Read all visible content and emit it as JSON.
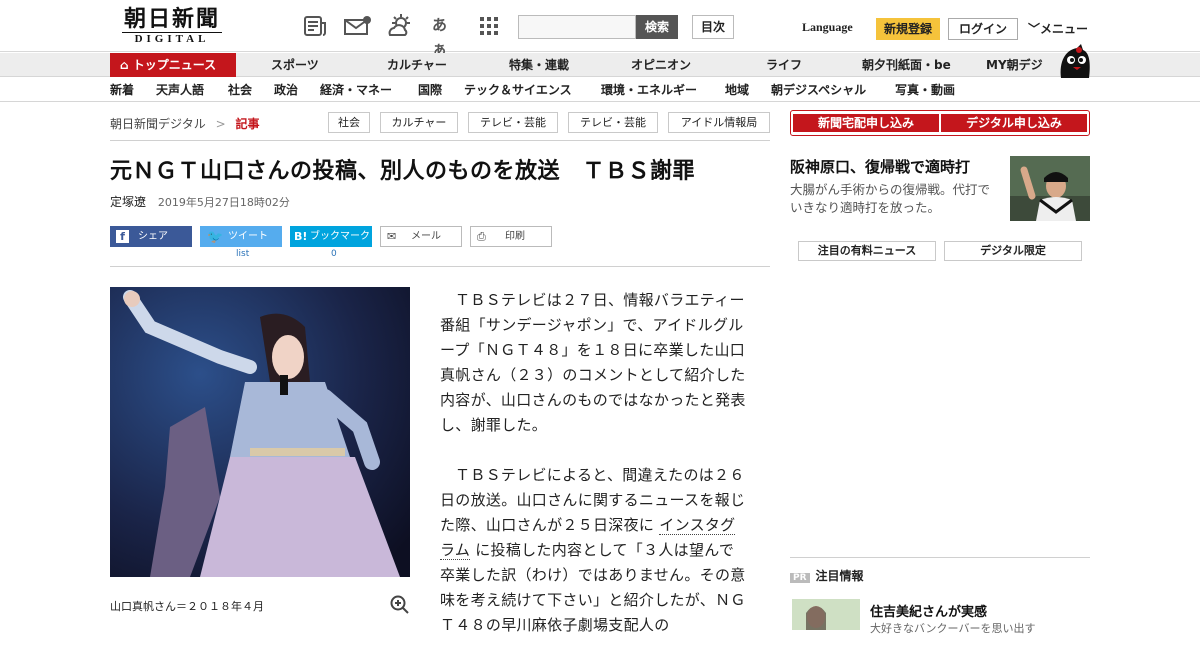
{
  "header": {
    "logo_jp": "朝日新聞",
    "logo_en": "DIGITAL",
    "search_button": "検索",
    "toc_button": "目次",
    "language": "Language",
    "register": "新規登録",
    "login": "ログイン",
    "menu": "メニュー",
    "icons": [
      "newspaper-icon",
      "weather-mail-icon",
      "weather-sun-cloud-icon",
      "font-size-icon",
      "grid-icon"
    ],
    "font_glyph": "あぁ"
  },
  "nav_primary": [
    "トップニュース",
    "スポーツ",
    "カルチャー",
    "特集・連載",
    "オピニオン",
    "ライフ",
    "朝夕刊紙面・be",
    "MY朝デジ"
  ],
  "nav_secondary": [
    "新着",
    "天声人語",
    "社会",
    "政治",
    "経済・マネー",
    "国際",
    "テック＆サイエンス",
    "環境・エネルギー",
    "地域",
    "朝デジスペシャル",
    "写真・動画"
  ],
  "breadcrumb": {
    "home": "朝日新聞デジタル",
    "sep": ">",
    "current": "記事"
  },
  "tags": [
    "社会",
    "カルチャー",
    "テレビ・芸能",
    "テレビ・芸能",
    "アイドル情報局"
  ],
  "article": {
    "title": "元ＮＧＴ山口さんの投稿、別人のものを放送　ＴＢＳ謝罪",
    "author": "定塚遼",
    "date": "2019年5月27日18時02分",
    "share": {
      "facebook": "シェア",
      "twitter": "ツイート",
      "hatena": "ブックマーク",
      "mail": "メール",
      "print": "印刷",
      "twitter_sub": "list",
      "hatena_count": "0"
    },
    "caption": "山口真帆さん＝２０１８年４月",
    "p1": "ＴＢＳテレビは２７日、情報バラエティー番組「サンデージャポン」で、アイドルグループ「ＮＧＴ４８」を１８日に卒業した山口真帆さん（２３）のコメントとして紹介した内容が、山口さんのものではなかったと発表し、謝罪した。",
    "p2_a": "ＴＢＳテレビによると、間違えたのは２６日の放送。山口さんに関するニュースを報じた際、山口さんが２５日深夜に",
    "p2_link": "インスタグラム",
    "p2_b": "に投稿した内容として「３人は望んで卒業した訳（わけ）ではありません。その意味を考え続けて下さい」と紹介したが、ＮＧＴ４８の早川麻依子劇場支配人の"
  },
  "sidebar": {
    "subscribe_paper": "新聞宅配申し込み",
    "subscribe_digital": "デジタル申し込み",
    "feature_title": "阪神原口、復帰戦で適時打",
    "feature_desc": "大腸がん手術からの復帰戦。代打でいきなり適時打を放った。",
    "tab1": "注目の有料ニュース",
    "tab2": "デジタル限定",
    "pr_badge": "PR",
    "pr_heading": "注目情報",
    "pr_title": "住吉美紀さんが実感",
    "pr_desc": "大好きなバンクーバーを思い出す"
  },
  "colors": {
    "brand_red": "#c4161c",
    "register_yellow": "#f5c33b",
    "facebook": "#3b5998",
    "twitter": "#55acee",
    "hatena": "#00a4de"
  }
}
